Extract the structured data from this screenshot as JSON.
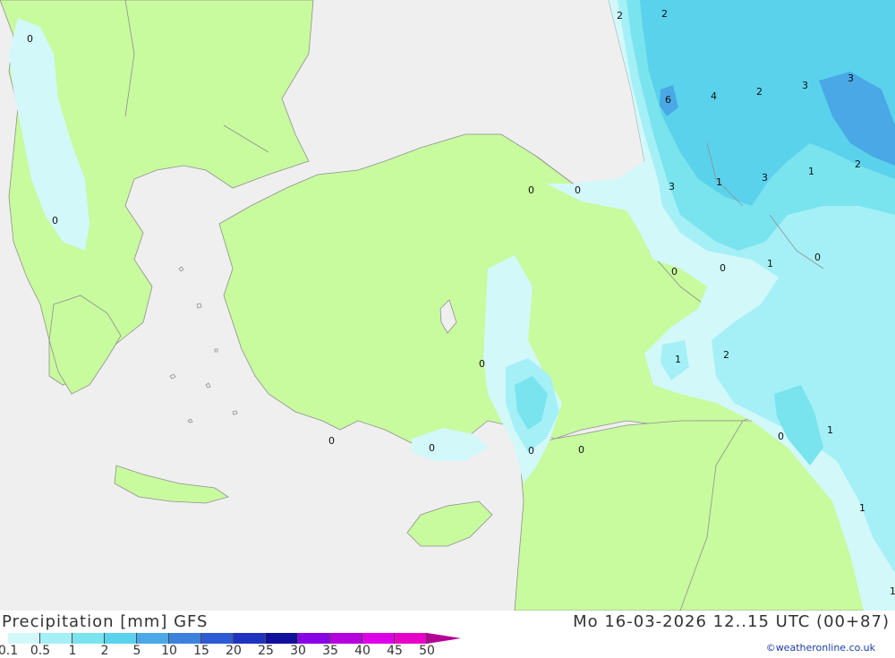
{
  "title": "Precipitation [mm] GFS",
  "datetime": "Mo 16-03-2026 12..15 UTC (00+87)",
  "credit": "©weatheronline.co.uk",
  "colors": {
    "sea": "#efefef",
    "land": "#c8fa9e",
    "border": "#909090",
    "precip_levels": [
      "#d2f8fa",
      "#a4f0f6",
      "#7ae4ee",
      "#5ad2ec",
      "#4aa8e6",
      "#3c82dc",
      "#2e5ad4",
      "#1e34c0",
      "#10109c",
      "#8a00e6",
      "#b400dc",
      "#dc00e6",
      "#e600c8",
      "#b40096"
    ]
  },
  "legend": {
    "labels": [
      "0.1",
      "0.5",
      "1",
      "2",
      "5",
      "10",
      "15",
      "20",
      "25",
      "30",
      "35",
      "40",
      "45",
      "50"
    ]
  },
  "map_values": [
    "0",
    "0",
    "0",
    "0",
    "0",
    "0",
    "0",
    "0",
    "0",
    "0",
    "0",
    "0",
    "0",
    "1",
    "1",
    "1",
    "1",
    "1",
    "1",
    "1",
    "2",
    "2",
    "2",
    "2",
    "2",
    "3",
    "3",
    "3",
    "3",
    "4",
    "6"
  ]
}
